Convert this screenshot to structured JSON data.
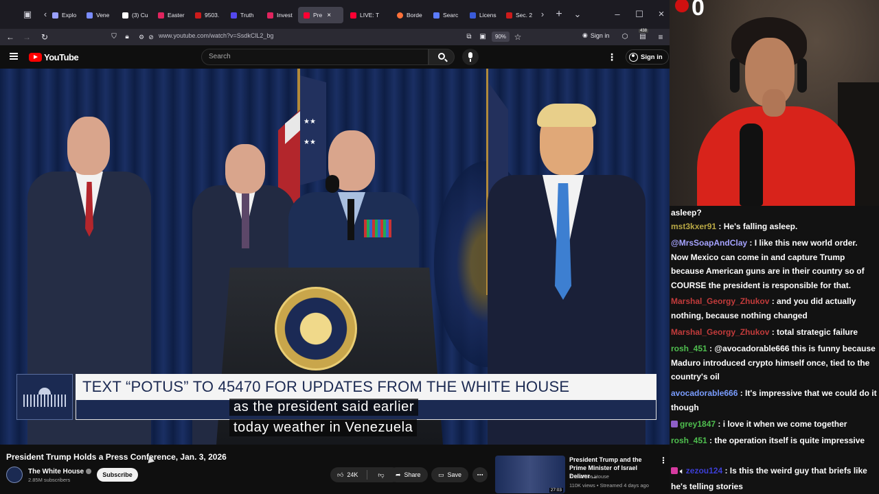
{
  "browser": {
    "tabs": [
      {
        "label": "Explo",
        "color": "#9aa0ff"
      },
      {
        "label": "Vene",
        "color": "#7a8cff"
      },
      {
        "label": "(3) Cu",
        "color": "#ffffff"
      },
      {
        "label": "Easter",
        "color": "#e0245e"
      },
      {
        "label": "9503.",
        "color": "#cc1b1b"
      },
      {
        "label": "Truth",
        "color": "#5448ee"
      },
      {
        "label": "Invest",
        "color": "#e0245e"
      },
      {
        "label": "Pre",
        "color": "#ff0033"
      },
      {
        "label": "LIVE: T",
        "color": "#ff0033"
      },
      {
        "label": "Borde",
        "color": "#ff7139"
      },
      {
        "label": "Searc",
        "color": "#5b7cff"
      },
      {
        "label": "Licens",
        "color": "#3a5bd9"
      },
      {
        "label": "Sec. 2",
        "color": "#cc1b1b"
      }
    ],
    "url": "www.youtube.com/watch?v=SsdkClL2_bg",
    "zoom": "90%",
    "sign_in": "Sign in",
    "extension_badge": "438"
  },
  "youtube": {
    "logo": "YouTube",
    "search_placeholder": "Search",
    "sign_in": "Sign in",
    "lower_third": "TEXT “POTUS” TO 45470 FOR UPDATES FROM THE WHITE HOUSE",
    "caption_line1": "as the president said earlier",
    "caption_line2": "today weather in Venezuela",
    "video_title": "President Trump Holds a Press Conference, Jan. 3, 2026",
    "channel_name": "The White House",
    "subscribers": "2.85M subscribers",
    "subscribe": "Subscribe",
    "likes": "24K",
    "share": "Share",
    "save": "Save",
    "recommended": {
      "title": "President Trump and the Prime Minister of Israel Deliver ...",
      "channel": "The White House",
      "meta": "110K views • Streamed 4 days ago",
      "duration": "27:03"
    }
  },
  "webcam": {
    "overlay": "0"
  },
  "chat": [
    {
      "user": "",
      "text": "asleep?",
      "color": "#ffffff"
    },
    {
      "user": "mst3kxer91",
      "text": ": He's falling asleep.",
      "color": "#b9a845"
    },
    {
      "user": "@MrsSoapAndClay",
      "text": ": I like this new world order. Now Mexico can come in and capture Trump because American guns are in their country so of COURSE the president is responsible for that.",
      "color": "#a6a3ff"
    },
    {
      "user": "Marshal_Georgy_Zhukov",
      "text": ": and you did actually nothing, because nothing changed",
      "color": "#c23b3b"
    },
    {
      "user": "Marshal_Georgy_Zhukov",
      "text": ": total strategic failure",
      "color": "#c23b3b"
    },
    {
      "user": "rosh_451",
      "text": ": @avocadorable666 this is funny because Maduro introduced crypto himself once, tied to the country's oil",
      "color": "#4fbf4f"
    },
    {
      "user": "avocadorable666",
      "text": ": It's impressive that we could do it though",
      "color": "#7a9dff"
    },
    {
      "user": "grey1847",
      "text": ": i love it when we come together",
      "color": "#4fbf4f"
    },
    {
      "user": "rosh_451",
      "text": ": the operation itself is quite impressive",
      "color": "#4fbf4f"
    },
    {
      "user": "zezou124",
      "text": ": Is this the weird guy that briefs like he's telling stories",
      "color": "#3d3fd6"
    }
  ]
}
